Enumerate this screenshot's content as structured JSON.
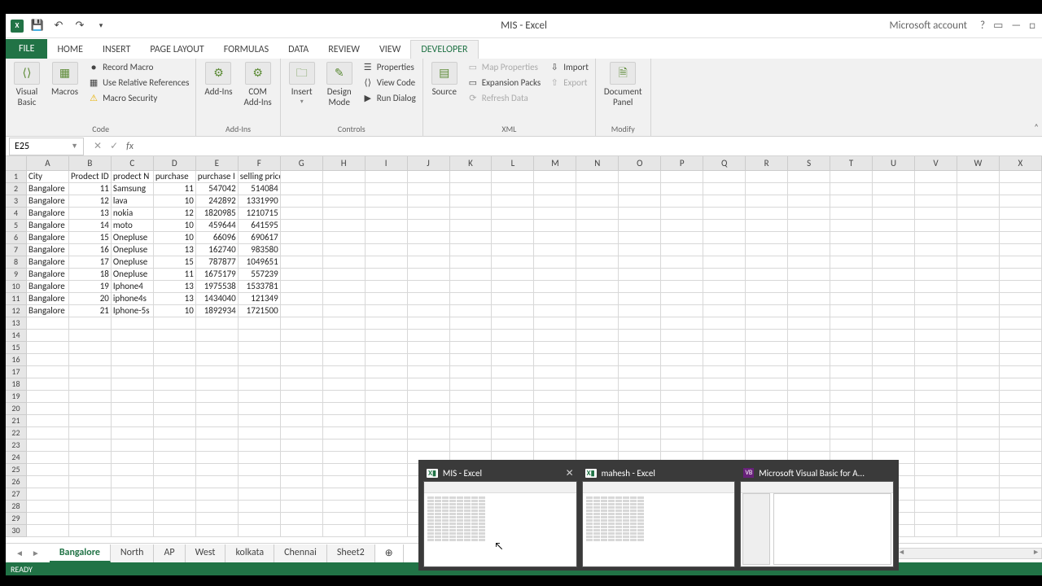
{
  "title": "MIS - Excel",
  "account": "Microsoft account",
  "tabs": [
    "FILE",
    "HOME",
    "INSERT",
    "PAGE LAYOUT",
    "FORMULAS",
    "DATA",
    "REVIEW",
    "VIEW",
    "DEVELOPER"
  ],
  "active_tab": "DEVELOPER",
  "ribbon": {
    "code": {
      "visual_basic": "Visual\nBasic",
      "macros": "Macros",
      "record": "Record Macro",
      "use_rel": "Use Relative References",
      "security": "Macro Security",
      "label": "Code"
    },
    "addins": {
      "addins": "Add-Ins",
      "com": "COM\nAdd-Ins",
      "label": "Add-Ins"
    },
    "controls": {
      "insert": "Insert",
      "design": "Design\nMode",
      "properties": "Properties",
      "view_code": "View Code",
      "run_dialog": "Run Dialog",
      "label": "Controls"
    },
    "xml": {
      "source": "Source",
      "map_props": "Map Properties",
      "expansion": "Expansion Packs",
      "refresh": "Refresh Data",
      "import": "Import",
      "export": "Export",
      "label": "XML"
    },
    "modify": {
      "doc_panel": "Document\nPanel",
      "label": "Modify"
    }
  },
  "namebox": "E25",
  "columns": [
    "A",
    "B",
    "C",
    "D",
    "E",
    "F",
    "G",
    "H",
    "I",
    "J",
    "K",
    "L",
    "M",
    "N",
    "O",
    "P",
    "Q",
    "R",
    "S",
    "T",
    "U",
    "V",
    "W",
    "X"
  ],
  "header_row": [
    "City",
    "Prodect ID",
    "prodect N",
    "purchase",
    "purchase I",
    "selling price"
  ],
  "data_rows": [
    [
      "Bangalore",
      "11",
      "Samsung",
      "11",
      "547042",
      "514084"
    ],
    [
      "Bangalore",
      "12",
      "lava",
      "10",
      "242892",
      "1331990"
    ],
    [
      "Bangalore",
      "13",
      "nokia",
      "12",
      "1820985",
      "1210715"
    ],
    [
      "Bangalore",
      "14",
      "moto",
      "10",
      "459644",
      "641595"
    ],
    [
      "Bangalore",
      "15",
      "Onepluse",
      "10",
      "66096",
      "690617"
    ],
    [
      "Bangalore",
      "16",
      "Onepluse",
      "13",
      "162740",
      "983580"
    ],
    [
      "Bangalore",
      "17",
      "Onepluse",
      "15",
      "787877",
      "1049651"
    ],
    [
      "Bangalore",
      "18",
      "Onepluse",
      "11",
      "1675179",
      "557239"
    ],
    [
      "Bangalore",
      "19",
      "Iphone4",
      "13",
      "1975538",
      "1533781"
    ],
    [
      "Bangalore",
      "20",
      "iphone4s",
      "13",
      "1434040",
      "121349"
    ],
    [
      "Bangalore",
      "21",
      "Iphone-5s",
      "10",
      "1892934",
      "1721500"
    ]
  ],
  "sheets": [
    "Bangalore",
    "North",
    "AP",
    "West",
    "kolkata",
    "Chennai",
    "Sheet2"
  ],
  "active_sheet": "Bangalore",
  "status": "READY",
  "task_items": [
    {
      "icon": "xl",
      "title": "MIS - Excel",
      "close": true
    },
    {
      "icon": "xl",
      "title": "mahesh - Excel",
      "close": false
    },
    {
      "icon": "vb",
      "title": "Microsoft Visual Basic for A...",
      "close": false
    }
  ],
  "chart_data": {
    "type": "table",
    "columns": [
      "City",
      "Prodect ID",
      "prodect Name",
      "purchase",
      "purchase I",
      "selling price"
    ],
    "rows": [
      [
        "Bangalore",
        11,
        "Samsung",
        11,
        547042,
        514084
      ],
      [
        "Bangalore",
        12,
        "lava",
        10,
        242892,
        1331990
      ],
      [
        "Bangalore",
        13,
        "nokia",
        12,
        1820985,
        1210715
      ],
      [
        "Bangalore",
        14,
        "moto",
        10,
        459644,
        641595
      ],
      [
        "Bangalore",
        15,
        "Onepluse",
        10,
        66096,
        690617
      ],
      [
        "Bangalore",
        16,
        "Onepluse",
        13,
        162740,
        983580
      ],
      [
        "Bangalore",
        17,
        "Onepluse",
        15,
        787877,
        1049651
      ],
      [
        "Bangalore",
        18,
        "Onepluse",
        11,
        1675179,
        557239
      ],
      [
        "Bangalore",
        19,
        "Iphone4",
        13,
        1975538,
        1533781
      ],
      [
        "Bangalore",
        20,
        "iphone4s",
        13,
        1434040,
        121349
      ],
      [
        "Bangalore",
        21,
        "Iphone-5s",
        10,
        1892934,
        1721500
      ]
    ]
  }
}
